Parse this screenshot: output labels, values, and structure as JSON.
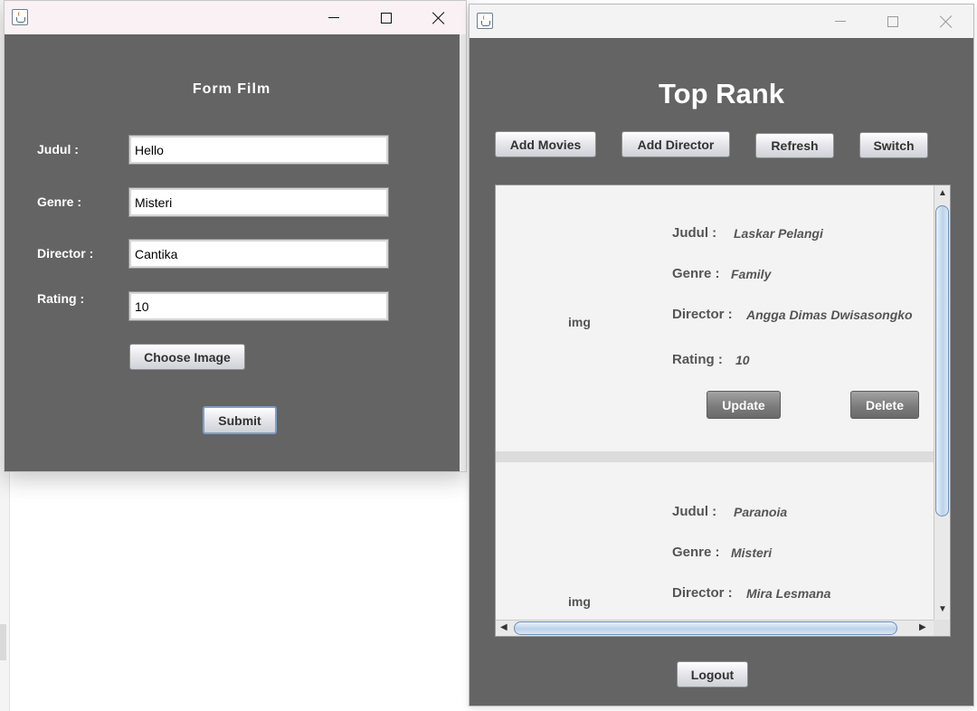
{
  "form_window": {
    "title": "Form Film",
    "fields": [
      {
        "label": "Judul :",
        "value": "Hello"
      },
      {
        "label": "Genre :",
        "value": "Misteri"
      },
      {
        "label": "Director :",
        "value": "Cantika"
      },
      {
        "label": "Rating :",
        "value": "10"
      }
    ],
    "choose_image_label": "Choose Image",
    "submit_label": "Submit"
  },
  "main_window": {
    "title": "Top Rank",
    "toolbar": {
      "add_movies": "Add Movies",
      "add_director": "Add Director",
      "refresh": "Refresh",
      "switch": "Switch"
    },
    "movies": [
      {
        "img": "img",
        "judul_label": "Judul :",
        "judul": "Laskar Pelangi",
        "genre_label": "Genre :",
        "genre": "Family",
        "director_label": "Director :",
        "director": "Angga Dimas Dwisasongko",
        "rating_label": "Rating :",
        "rating": "10",
        "update_label": "Update",
        "delete_label": "Delete"
      },
      {
        "img": "img",
        "judul_label": "Judul :",
        "judul": "Paranoia",
        "genre_label": "Genre :",
        "genre": "Misteri",
        "director_label": "Director :",
        "director": "Mira Lesmana"
      }
    ],
    "logout_label": "Logout"
  },
  "icons": {
    "window_icon": "java-icon",
    "minimize": "minimize-icon",
    "maximize": "maximize-icon",
    "close": "close-icon"
  },
  "colors": {
    "panel_bg": "#646464",
    "form_titlebar": "#f9f1f4",
    "scrollbar_thumb": "#bcd2ea"
  }
}
